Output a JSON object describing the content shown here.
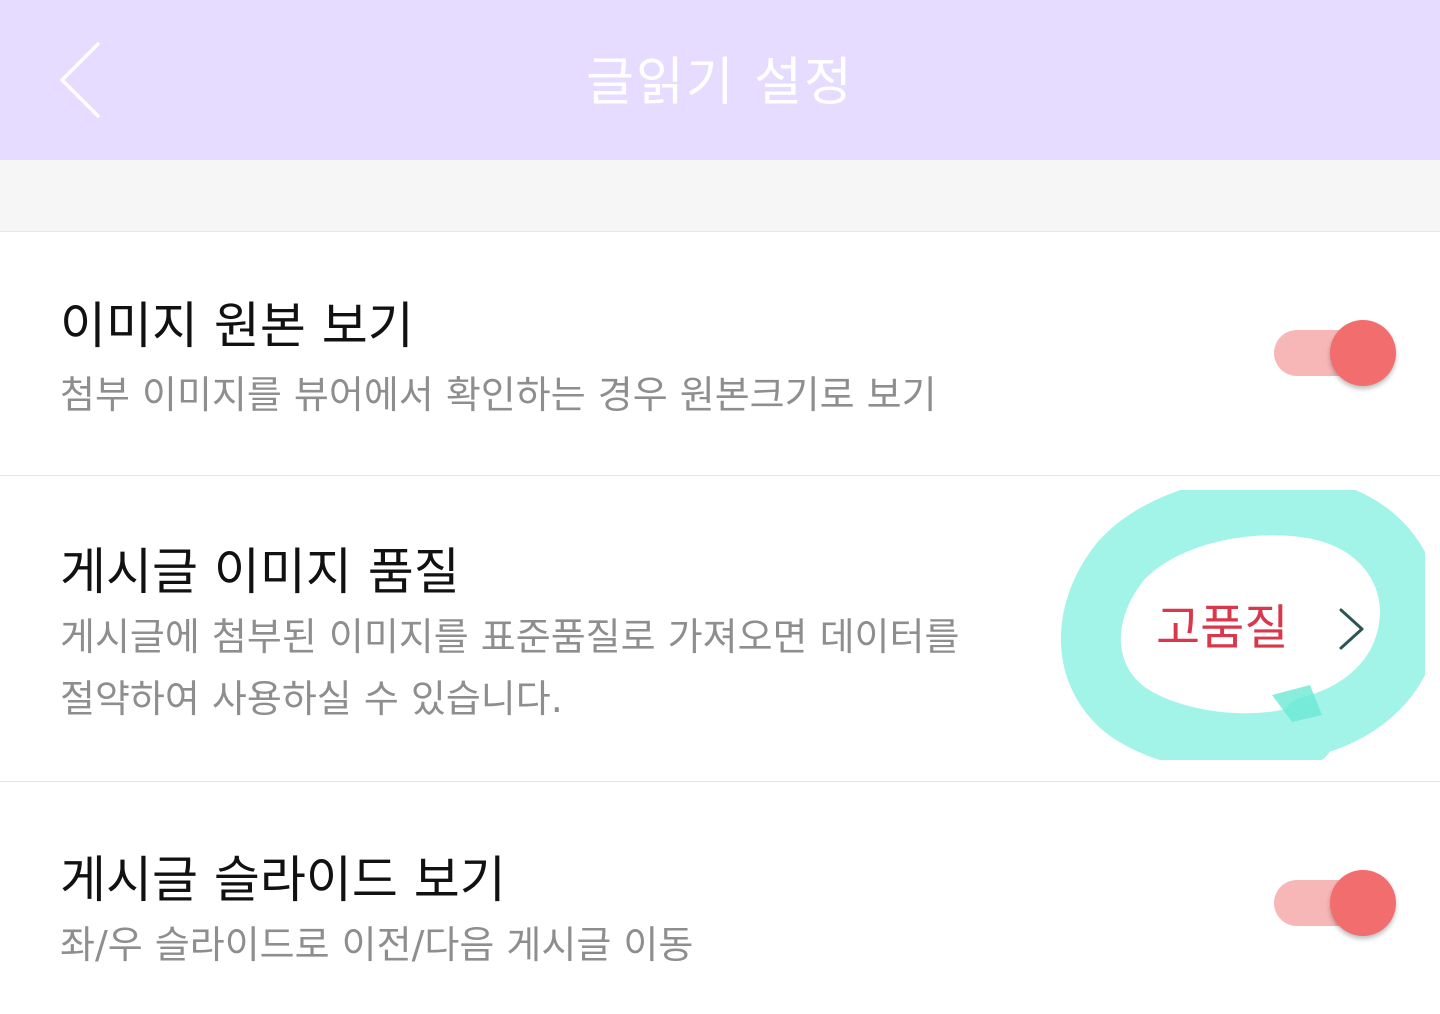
{
  "header": {
    "title": "글읽기 설정",
    "back_icon": "chevron-left-icon",
    "background_color": "#e5dcff"
  },
  "settings": [
    {
      "title": "이미지 원본 보기",
      "description_lines": [
        "첨부 이미지를 뷰어에서 확인하는 경우 원본크기로 보기"
      ],
      "control": "toggle",
      "enabled": true
    },
    {
      "title": "게시글 이미지 품질",
      "description_lines": [
        "게시글에 첨부된 이미지를 표준품질로 가져오면 데이터를",
        "절약하여 사용하실 수 있습니다."
      ],
      "control": "selector",
      "value": "고품질",
      "value_icon": "chevron-right-icon"
    },
    {
      "title": "게시글 슬라이드 보기",
      "description_lines": [
        "좌/우 슬라이드로 이전/다음 게시글 이동"
      ],
      "control": "toggle",
      "enabled": true
    }
  ],
  "colors": {
    "toggle_track": "#f7b7b6",
    "toggle_knob": "#f26e6e",
    "selected_value": "#d9384c",
    "highlight_marker": "#a3f4e8"
  }
}
